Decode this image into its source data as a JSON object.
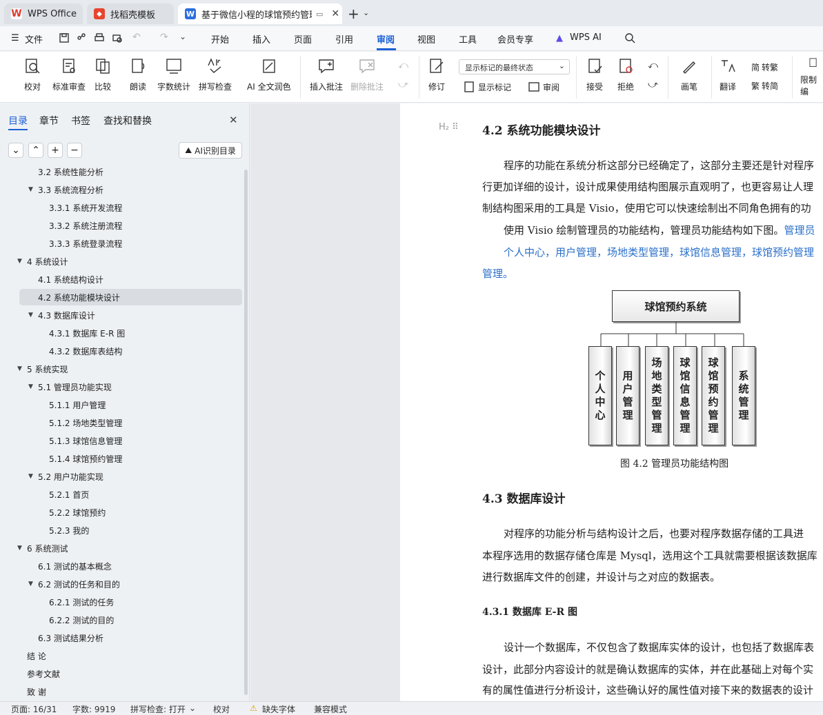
{
  "tabs": [
    {
      "label": "WPS Office",
      "logo": "W"
    },
    {
      "label": "找稻壳模板",
      "logo": "稻"
    },
    {
      "label": "基于微信小程的球馆预约管理",
      "logo": "W"
    }
  ],
  "menu": [
    "文件",
    "开始",
    "插入",
    "页面",
    "引用",
    "审阅",
    "视图",
    "工具",
    "会员专享",
    "WPS AI"
  ],
  "ribbon": {
    "proof": "校对",
    "std_review": "标准审查",
    "compare": "比较",
    "read": "朗读",
    "wordcount": "字数统计",
    "spell": "拼写检查",
    "ai_polish": "AI 全文润色",
    "insert_comment": "插入批注",
    "delete_comment": "删除批注",
    "revise": "修订",
    "markup_select": "显示标记的最终状态",
    "show_markup": "显示标记",
    "review": "审阅",
    "accept": "接受",
    "reject": "拒绝",
    "ink": "画笔",
    "translate": "翻译",
    "to_trad": "转繁",
    "to_simp": "转简",
    "restrict": "限制编"
  },
  "nav": {
    "tabs": [
      "目录",
      "章节",
      "书签",
      "查找和替换"
    ],
    "ai_toc": "AI识别目录",
    "items": [
      {
        "label": "3.2  系统性能分析",
        "level": 2,
        "arrow": ""
      },
      {
        "label": "3.3  系统流程分析",
        "level": 2,
        "arrow": "▼"
      },
      {
        "label": "3.3.1  系统开发流程",
        "level": 3,
        "arrow": ""
      },
      {
        "label": "3.3.2  系统注册流程",
        "level": 3,
        "arrow": ""
      },
      {
        "label": "3.3.3  系统登录流程",
        "level": 3,
        "arrow": ""
      },
      {
        "label": "4  系统设计",
        "level": 1,
        "arrow": "▼"
      },
      {
        "label": "4.1  系统结构设计",
        "level": 2,
        "arrow": ""
      },
      {
        "label": "4.2 系统功能模块设计",
        "level": 2,
        "arrow": "",
        "selected": true
      },
      {
        "label": "4.3 数据库设计",
        "level": 2,
        "arrow": "▼"
      },
      {
        "label": "4.3.1 数据库 E-R 图",
        "level": 3,
        "arrow": ""
      },
      {
        "label": "4.3.2  数据库表结构",
        "level": 3,
        "arrow": ""
      },
      {
        "label": "5  系统实现",
        "level": 1,
        "arrow": "▼"
      },
      {
        "label": "5.1  管理员功能实现",
        "level": 2,
        "arrow": "▼"
      },
      {
        "label": "5.1.1  用户管理",
        "level": 3,
        "arrow": ""
      },
      {
        "label": "5.1.2  场地类型管理",
        "level": 3,
        "arrow": ""
      },
      {
        "label": "5.1.3  球馆信息管理",
        "level": 3,
        "arrow": ""
      },
      {
        "label": "5.1.4  球馆预约管理",
        "level": 3,
        "arrow": ""
      },
      {
        "label": "5.2  用户功能实现",
        "level": 2,
        "arrow": "▼"
      },
      {
        "label": "5.2.1  首页",
        "level": 3,
        "arrow": ""
      },
      {
        "label": "5.2.2  球馆预约",
        "level": 3,
        "arrow": ""
      },
      {
        "label": "5.2.3  我的",
        "level": 3,
        "arrow": ""
      },
      {
        "label": "6 系统测试",
        "level": 1,
        "arrow": "▼"
      },
      {
        "label": "6.1  测试的基本概念",
        "level": 2,
        "arrow": ""
      },
      {
        "label": "6.2  测试的任务和目的",
        "level": 2,
        "arrow": "▼"
      },
      {
        "label": "6.2.1 测试的任务",
        "level": 3,
        "arrow": ""
      },
      {
        "label": "6.2.2 测试的目的",
        "level": 3,
        "arrow": ""
      },
      {
        "label": "6.3  测试结果分析",
        "level": 2,
        "arrow": ""
      },
      {
        "label": "结    论",
        "level": 1,
        "arrow": ""
      },
      {
        "label": "参考文献",
        "level": 1,
        "arrow": ""
      },
      {
        "label": "致    谢",
        "level": 1,
        "arrow": ""
      }
    ]
  },
  "doc": {
    "h_42": "4.2 系统功能模块设计",
    "p1": "程序的功能在系统分析这部分已经确定了，这部分主要还是针对程序",
    "p2": "行更加详细的设计，设计成果使用结构图展示直观明了，也更容易让人理",
    "p3": "制结构图采用的工具是 Visio，使用它可以快速绘制出不同角色拥有的功",
    "p4a": "使用 Visio 绘制管理员的功能结构，管理员功能结构如下图。",
    "p4b": "管理员",
    "p5": "个人中心，用户管理，场地类型管理，球馆信息管理，球馆预约管理",
    "p6": "管理。",
    "diagram_root": "球馆预约系统",
    "diagram_children": [
      "个人中心",
      "用户管理",
      "场地类型管理",
      "球馆信息管理",
      "球馆预约管理",
      "系统管理"
    ],
    "caption": "图 4.2  管理员功能结构图",
    "h_43": "4.3 数据库设计",
    "p7": "对程序的功能分析与结构设计之后，也要对程序数据存储的工具进",
    "p8": "本程序选用的数据存储仓库是 Mysql，选用这个工具就需要根据该数据库",
    "p9": "进行数据库文件的创建，并设计与之对应的数据表。",
    "h_431": "4.3.1 数据库 E-R 图",
    "p10": "设计一个数据库，不仅包含了数据库实体的设计，也包括了数据库表",
    "p11": "设计，此部分内容设计的就是确认数据库的实体，并在此基础上对每个实",
    "p12": "有的属性值进行分析设计，这些确认好的属性值对接下来的数据表的设计"
  },
  "status": {
    "page": "页面: 16/31",
    "words": "字数: 9919",
    "spell": "拼写检查: 打开",
    "proof": "校对",
    "missing_font": "缺失字体",
    "compat": "兼容模式"
  }
}
